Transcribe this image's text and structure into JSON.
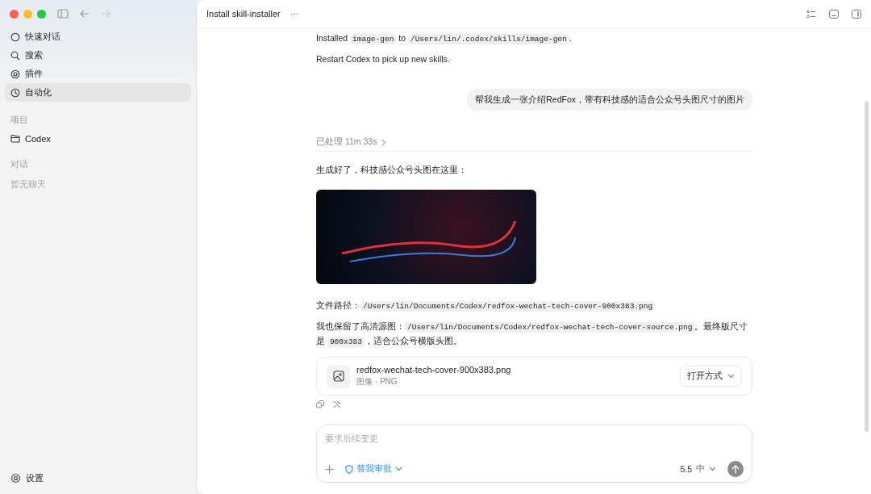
{
  "sidebar": {
    "nav": [
      {
        "label": "快速对话",
        "kind": "chat",
        "selected": false
      },
      {
        "label": "搜索",
        "kind": "search",
        "selected": false
      },
      {
        "label": "插件",
        "kind": "at",
        "selected": false
      },
      {
        "label": "自动化",
        "kind": "clock",
        "selected": true
      }
    ],
    "projects_heading": "项目",
    "projects": [
      {
        "label": "Codex"
      }
    ],
    "chats_heading": "对话",
    "chats_empty": "暂无聊天",
    "settings": "设置"
  },
  "header": {
    "title": "Install skill-installer",
    "more": "···"
  },
  "messages": [
    {
      "kind": "assistant_text",
      "segments": [
        {
          "kind": "text",
          "text": "Installed "
        },
        {
          "kind": "code",
          "text": "image-gen"
        },
        {
          "kind": "text",
          "text": " to "
        },
        {
          "kind": "code",
          "text": "/Users/lin/.codex/skills/image-gen"
        },
        {
          "kind": "text",
          "text": "."
        }
      ]
    },
    {
      "kind": "assistant_text",
      "segments": [
        {
          "kind": "text",
          "text": "Restart Codex to pick up new skills."
        }
      ]
    },
    {
      "kind": "user",
      "text": "帮我生成一张介绍RedFox，带有科技感的适合公众号头图尺寸的图片"
    },
    {
      "kind": "processed",
      "text": "已处理 11m 33s"
    },
    {
      "kind": "assistant_text",
      "segments": [
        {
          "kind": "text",
          "text": "生成好了，科技感公众号头图在这里："
        }
      ]
    },
    {
      "kind": "image"
    },
    {
      "kind": "assistant_text",
      "segments": [
        {
          "kind": "text",
          "text": "文件路径："
        },
        {
          "kind": "code",
          "text": "/Users/lin/Documents/Codex/redfox-wechat-tech-cover-900x383.png"
        }
      ]
    },
    {
      "kind": "assistant_text",
      "segments": [
        {
          "kind": "text",
          "text": "我也保留了高清源图："
        },
        {
          "kind": "code",
          "text": "/Users/lin/Documents/Codex/redfox-wechat-tech-cover-source.png"
        },
        {
          "kind": "text",
          "text": "。最终版尺寸是 "
        },
        {
          "kind": "code",
          "text": "900x383"
        },
        {
          "kind": "text",
          "text": "，适合公众号横版头图。"
        }
      ]
    },
    {
      "kind": "file",
      "name": "redfox-wechat-tech-cover-900x383.png",
      "meta": "图像 · PNG",
      "action": "打开方式"
    },
    {
      "kind": "actions"
    }
  ],
  "composer": {
    "placeholder": "要求后续变更",
    "approval": "替我审批",
    "model": "5.5",
    "effort": "中"
  }
}
